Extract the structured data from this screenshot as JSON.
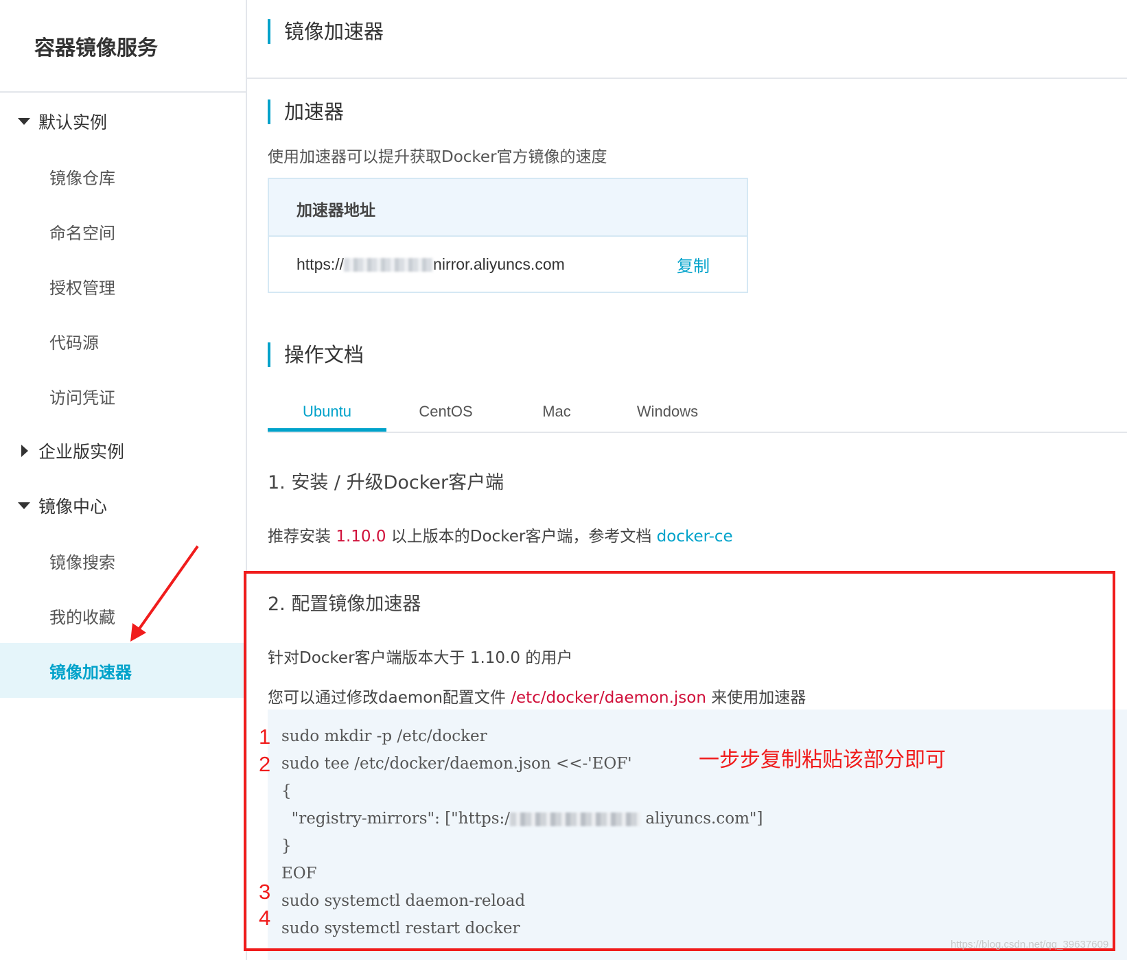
{
  "sidebar": {
    "title": "容器镜像服务",
    "groups": [
      {
        "label": "默认实例",
        "expanded": true,
        "items": [
          "镜像仓库",
          "命名空间",
          "授权管理",
          "代码源",
          "访问凭证"
        ]
      },
      {
        "label": "企业版实例",
        "expanded": false,
        "items": []
      },
      {
        "label": "镜像中心",
        "expanded": true,
        "items": [
          "镜像搜索",
          "我的收藏",
          "镜像加速器"
        ]
      }
    ],
    "active_item": "镜像加速器"
  },
  "page": {
    "title": "镜像加速器",
    "accelerator": {
      "heading": "加速器",
      "description": "使用加速器可以提升获取Docker官方镜像的速度",
      "box_header": "加速器地址",
      "url_prefix": "https://",
      "url_suffix": "nirror.aliyuncs.com",
      "copy_label": "复制"
    },
    "docs": {
      "heading": "操作文档",
      "tabs": [
        "Ubuntu",
        "CentOS",
        "Mac",
        "Windows"
      ],
      "active_tab": "Ubuntu",
      "step1": {
        "title": "1. 安装 / 升级Docker客户端",
        "text_before": "推荐安装 ",
        "version": "1.10.0",
        "text_middle": " 以上版本的Docker客户端，参考文档 ",
        "link": "docker-ce"
      },
      "step2": {
        "title": "2. 配置镜像加速器",
        "line1": "针对Docker客户端版本大于 1.10.0 的用户",
        "line2_before": "您可以通过修改daemon配置文件 ",
        "line2_path": "/etc/docker/daemon.json",
        "line2_after": " 来使用加速器",
        "code": [
          "sudo mkdir -p /etc/docker",
          "sudo tee /etc/docker/daemon.json <<-'EOF'",
          "{",
          "  \"registry-mirrors\": [\"https:/",
          "aliyuncs.com\"]",
          "}",
          "EOF",
          "sudo systemctl daemon-reload",
          "sudo systemctl restart docker"
        ]
      }
    }
  },
  "annotations": {
    "numbers": [
      "1",
      "2",
      "3",
      "4"
    ],
    "note": "一步步复制粘贴该部分即可",
    "color": "#f01c1c"
  },
  "watermark": "https://blog.csdn.net/qq_39637609",
  "colors": {
    "accent": "#00a2ca",
    "highlight_red": "#d0103a",
    "active_bg": "#e5f5fa"
  }
}
